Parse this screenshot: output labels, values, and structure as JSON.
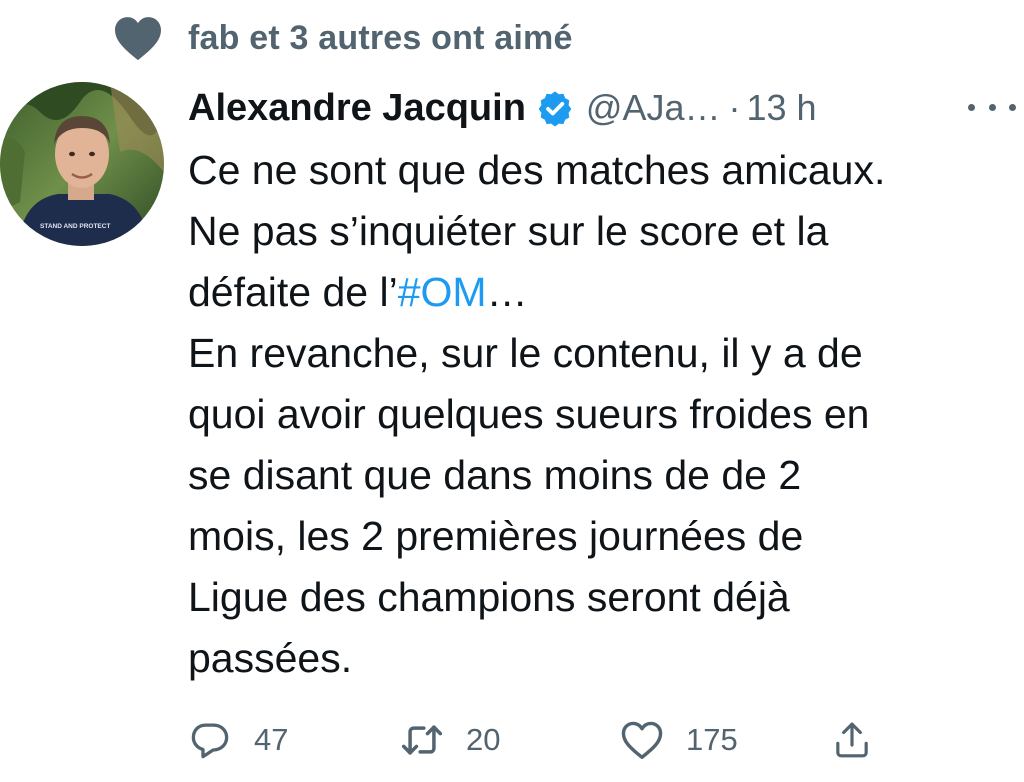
{
  "social_context": {
    "icon": "heart-icon",
    "text": "fab et 3 autres ont aimé"
  },
  "author": {
    "name": "Alexandre Jacquin",
    "verified_icon": "verified-badge-icon",
    "handle": "@AJa…",
    "separator": "·",
    "time": "13 h",
    "avatar_shirt_text": "STAND AND PROTECT"
  },
  "tweet": {
    "lines": [
      {
        "pre": "Ce ne sont que des matches amicaux."
      },
      {
        "pre": "Ne pas s’inquiéter sur le score et la"
      },
      {
        "pre": "défaite de l’",
        "hashtag": "#OM",
        "post": "…"
      },
      {
        "pre": "En revanche, sur le contenu, il y a de"
      },
      {
        "pre": "quoi avoir quelques sueurs froides en"
      },
      {
        "pre": "se disant que dans moins de de 2"
      },
      {
        "pre": "mois, les 2 premières journées de"
      },
      {
        "pre": "Ligue des champions seront déjà"
      },
      {
        "pre": "passées."
      }
    ]
  },
  "actions": {
    "reply": {
      "icon": "reply-icon",
      "count": "47"
    },
    "retweet": {
      "icon": "retweet-icon",
      "count": "20"
    },
    "like": {
      "icon": "like-heart-icon",
      "count": "175"
    },
    "share": {
      "icon": "share-icon"
    }
  },
  "colors": {
    "text_primary": "#0f1419",
    "text_secondary": "#536471",
    "link": "#1d9bf0",
    "verified": "#1d9bf0"
  }
}
